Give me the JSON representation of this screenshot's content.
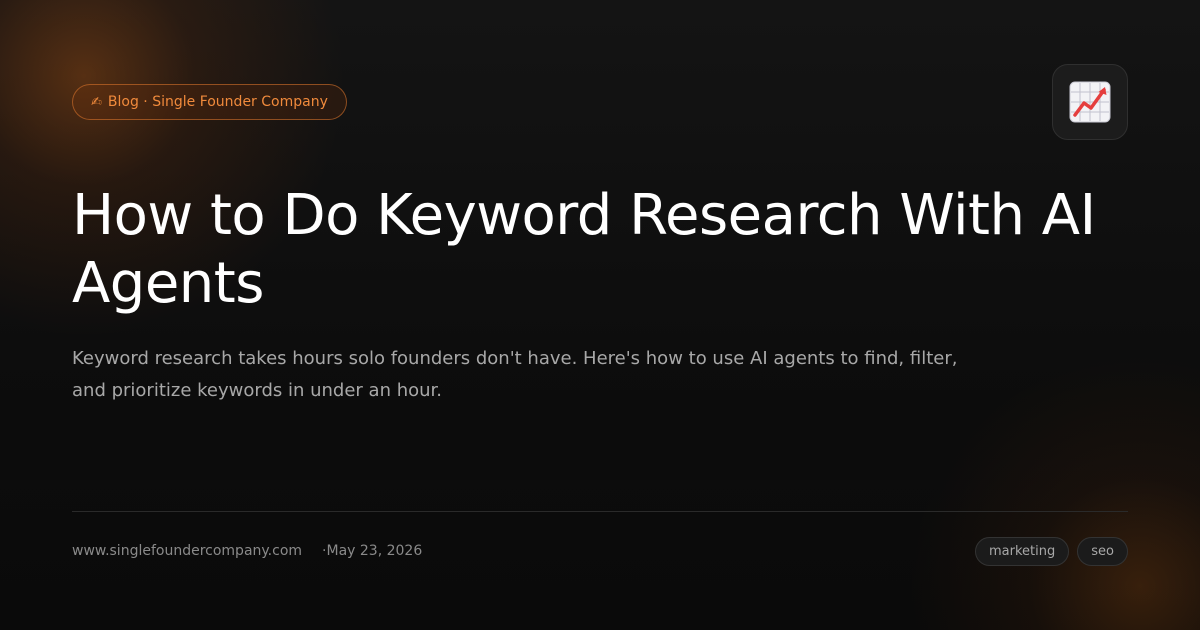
{
  "badge": {
    "icon": "✍",
    "label": "Blog · Single Founder Company"
  },
  "logo": {
    "icon": "chart-increasing-icon",
    "accent": "#e53e3e"
  },
  "post": {
    "title": "How to Do Keyword Research With AI Agents",
    "description": "Keyword research takes hours solo founders don't have. Here's how to use AI agents to find, filter, and prioritize keywords in under an hour."
  },
  "footer": {
    "site": "www.singlefoundercompany.com",
    "separator": "·",
    "date": "May 23, 2026",
    "tags": [
      "marketing",
      "seo"
    ]
  },
  "colors": {
    "accent": "#f08a3c",
    "background": "#0b0b0b"
  }
}
